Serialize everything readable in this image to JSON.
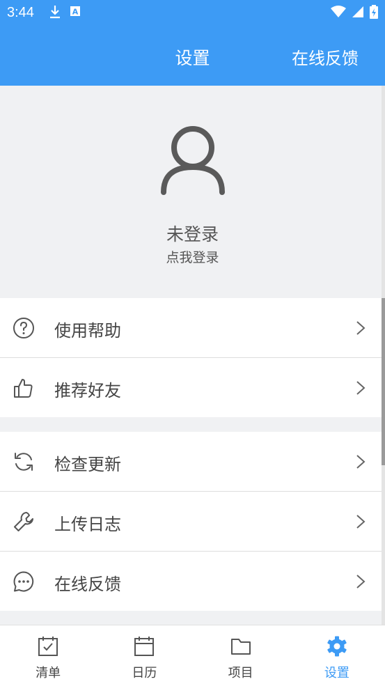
{
  "status_bar": {
    "time": "3:44"
  },
  "appbar": {
    "title": "设置",
    "action_label": "在线反馈"
  },
  "profile": {
    "name": "未登录",
    "subtitle": "点我登录"
  },
  "menu_group_1": [
    {
      "label": "使用帮助",
      "icon": "help-circle-icon"
    },
    {
      "label": "推荐好友",
      "icon": "thumbs-up-icon"
    }
  ],
  "menu_group_2": [
    {
      "label": "检查更新",
      "icon": "refresh-icon"
    },
    {
      "label": "上传日志",
      "icon": "wrench-icon"
    },
    {
      "label": "在线反馈",
      "icon": "chat-bubble-icon"
    }
  ],
  "bottom_nav": [
    {
      "label": "清单",
      "icon": "checklist-calendar-icon",
      "active": false
    },
    {
      "label": "日历",
      "icon": "calendar-icon",
      "active": false
    },
    {
      "label": "项目",
      "icon": "folder-icon",
      "active": false
    },
    {
      "label": "设置",
      "icon": "gear-icon",
      "active": true
    }
  ],
  "colors": {
    "primary": "#3d9bf5",
    "background": "#f0f1f3",
    "text": "#444444"
  }
}
